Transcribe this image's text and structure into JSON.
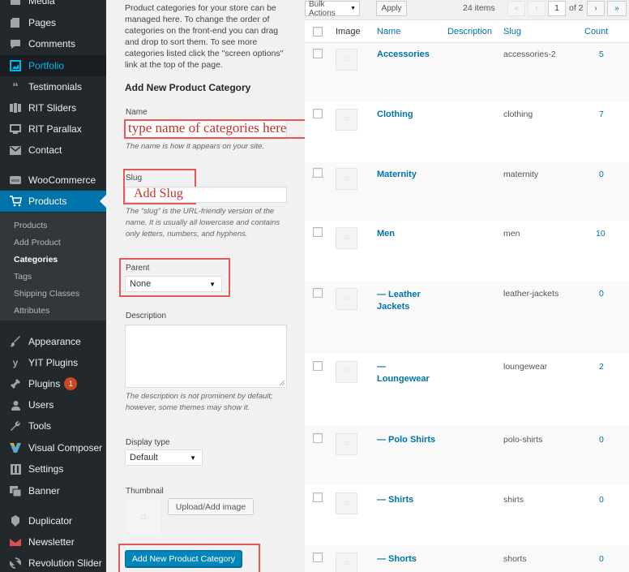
{
  "sidebar": {
    "items": [
      {
        "label": "Media",
        "icon": "media-icon"
      },
      {
        "label": "Pages",
        "icon": "pages-icon"
      },
      {
        "label": "Comments",
        "icon": "comments-icon"
      },
      {
        "label": "Portfolio",
        "icon": "portfolio-icon"
      },
      {
        "label": "Testimonials",
        "icon": "quote-icon"
      },
      {
        "label": "RIT Sliders",
        "icon": "slider-icon"
      },
      {
        "label": "RIT Parallax",
        "icon": "parallax-icon"
      },
      {
        "label": "Contact",
        "icon": "mail-icon"
      },
      {
        "label": "WooCommerce",
        "icon": "woocommerce-icon"
      },
      {
        "label": "Products",
        "icon": "cart-icon"
      },
      {
        "label": "Appearance",
        "icon": "brush-icon"
      },
      {
        "label": "YIT Plugins",
        "icon": "yit-icon"
      },
      {
        "label": "Plugins",
        "icon": "plugin-icon",
        "badge": "1"
      },
      {
        "label": "Users",
        "icon": "users-icon"
      },
      {
        "label": "Tools",
        "icon": "wrench-icon"
      },
      {
        "label": "Visual Composer",
        "icon": "composer-icon"
      },
      {
        "label": "Settings",
        "icon": "settings-icon"
      },
      {
        "label": "Banner",
        "icon": "banner-icon"
      },
      {
        "label": "Duplicator",
        "icon": "duplicator-icon"
      },
      {
        "label": "Newsletter",
        "icon": "newsletter-icon"
      },
      {
        "label": "Revolution Slider",
        "icon": "refresh-icon"
      }
    ],
    "submenu": [
      "Products",
      "Add Product",
      "Categories",
      "Tags",
      "Shipping Classes",
      "Attributes"
    ],
    "colors": {
      "background": "#23282d",
      "active": "#0073aa",
      "submenu_bg": "#32373c",
      "badge": "#ca4a1f"
    }
  },
  "form": {
    "intro_lines": [
      "Product categories for your store can be",
      "managed here. To change the order of",
      "categories on the front-end you can drag",
      "and drop to sort them. To see more",
      "categories listed click the \"screen options\"",
      "link at the top of the page."
    ],
    "heading": "Add New Product Category",
    "name_label": "Name",
    "name_value": "type name of categories here",
    "name_desc": "The name is how it appears on your site.",
    "slug_label": "Slug",
    "slug_value": "Add Slug",
    "slug_desc_lines": [
      "The “slug” is the URL-friendly version of the",
      "name. It is usually all lowercase and contains",
      "only letters, numbers, and hyphens."
    ],
    "parent_label": "Parent",
    "parent_value": "None",
    "description_label": "Description",
    "description_desc_lines": [
      "The description is not prominent by default;",
      "however, some themes may show it."
    ],
    "display_type_label": "Display type",
    "display_type_value": "Default",
    "thumbnail_label": "Thumbnail",
    "upload_button": "Upload/Add image",
    "submit_button": "Add New Product Category"
  },
  "table": {
    "bulk_actions": "Bulk Actions",
    "apply": "Apply",
    "items_count": "24 items",
    "pagination": {
      "first": "«",
      "prev": "‹",
      "current": "1",
      "of": "of 2",
      "next": "›",
      "last": "»"
    },
    "headers": {
      "image": "Image",
      "name": "Name",
      "description": "Description",
      "slug": "Slug",
      "count": "Count"
    },
    "rows": [
      {
        "name_lines": [
          "Accessories"
        ],
        "slug": "accessories-2",
        "count": "5"
      },
      {
        "name_lines": [
          "Clothing"
        ],
        "slug": "clothing",
        "count": "7"
      },
      {
        "name_lines": [
          "Maternity"
        ],
        "slug": "maternity",
        "count": "0"
      },
      {
        "name_lines": [
          "Men"
        ],
        "slug": "men",
        "count": "10"
      },
      {
        "name_lines": [
          "— Leather",
          "Jackets"
        ],
        "slug": "leather-jackets",
        "count": "0"
      },
      {
        "name_lines": [
          "—",
          "Loungewear"
        ],
        "slug": "loungewear",
        "count": "2"
      },
      {
        "name_lines": [
          "— Polo Shirts"
        ],
        "slug": "polo-shirts",
        "count": "0"
      },
      {
        "name_lines": [
          "— Shirts"
        ],
        "slug": "shirts",
        "count": "0"
      },
      {
        "name_lines": [
          "— Shorts"
        ],
        "slug": "shorts",
        "count": "0"
      }
    ]
  }
}
